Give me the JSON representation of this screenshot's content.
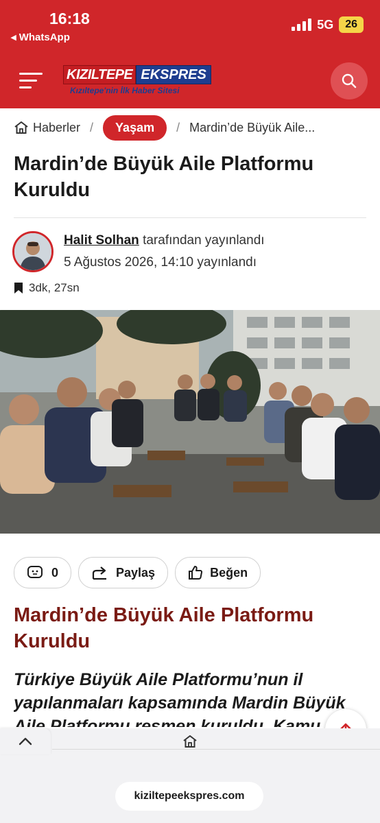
{
  "status_bar": {
    "time": "16:18",
    "back_app": "◂ WhatsApp",
    "network": "5G",
    "battery": "26"
  },
  "header": {
    "logo_part1": "KIZILTEPE",
    "logo_part2": "EKSPRES",
    "logo_tagline": "Kızıltepe'nin İlk Haber Sitesi",
    "brand_color": "#d0262a"
  },
  "breadcrumb": {
    "home": "Haberler",
    "separator": "/",
    "category": "Yaşam",
    "current": "Mardin’de Büyük Aile..."
  },
  "article": {
    "title": "Mardin’de Büyük Aile Platformu Kuruldu",
    "author": "Halit Solhan",
    "author_suffix": "tarafından yayınlandı",
    "date": "5 Ağustos 2026, 14:10 yayınlandı",
    "read_time": "3dk, 27sn",
    "heading": "Mardin’de Büyük Aile Platformu Kuruldu",
    "lead": "Türkiye Büyük Aile Platformu’nun il yapılanmaları kapsamında Mardin Büyük Aile Platformu resmen kuruldu. Kamu"
  },
  "actions": {
    "comments_count": "0",
    "share_label": "Paylaş",
    "like_label": "Beğen"
  },
  "browser": {
    "url": "kiziltepeekspres.com"
  }
}
